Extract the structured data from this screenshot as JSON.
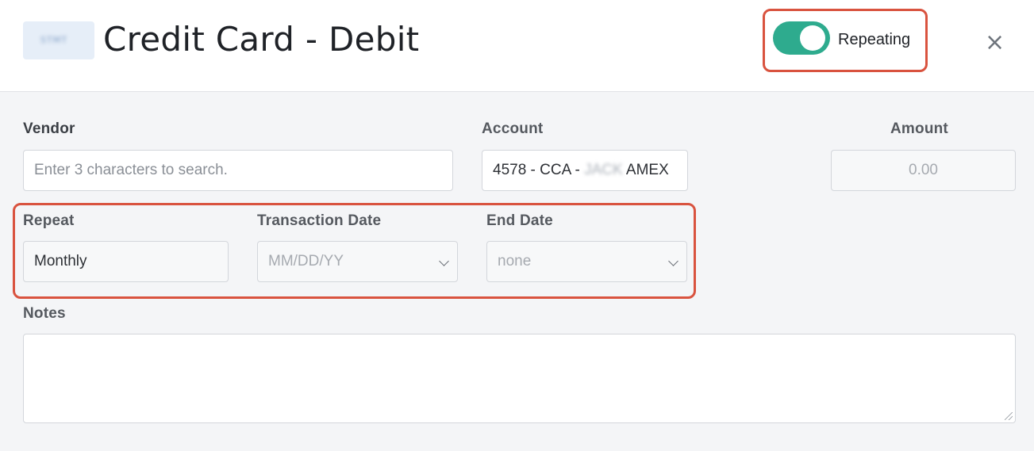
{
  "header": {
    "logo_text": "STMT",
    "title": "Credit Card - Debit",
    "repeating_toggle": {
      "label": "Repeating",
      "on": true,
      "color": "#2eab8e"
    },
    "close_glyph": "×"
  },
  "form": {
    "vendor": {
      "label": "Vendor",
      "placeholder": "Enter 3 characters to search."
    },
    "account": {
      "label": "Account",
      "value_prefix": "4578 - CCA - ",
      "value_redacted": "JACK",
      "value_suffix": " AMEX"
    },
    "amount": {
      "label": "Amount",
      "placeholder": "0.00"
    },
    "repeat": {
      "label": "Repeat",
      "value": "Monthly"
    },
    "transaction_date": {
      "label": "Transaction Date",
      "placeholder": "MM/DD/YY"
    },
    "end_date": {
      "label": "End Date",
      "value": "none"
    },
    "notes": {
      "label": "Notes",
      "value": ""
    }
  },
  "colors": {
    "highlight": "#d9533f",
    "toggle_on": "#2eab8e"
  }
}
